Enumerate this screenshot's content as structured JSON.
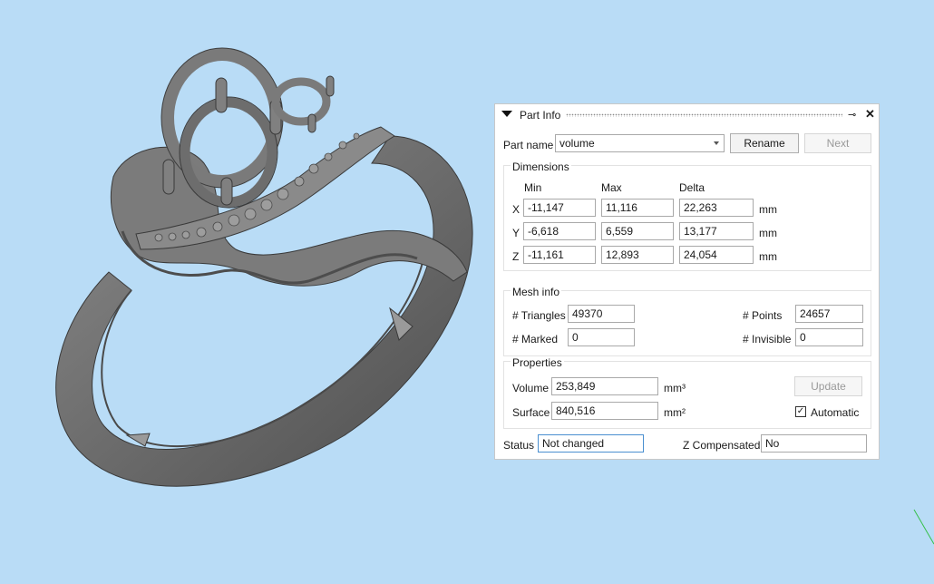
{
  "panel": {
    "title": "Part Info",
    "part_name_label": "Part name",
    "part_name_value": "volume",
    "rename_label": "Rename",
    "next_label": "Next",
    "dimensions": {
      "title": "Dimensions",
      "col_min": "Min",
      "col_max": "Max",
      "col_delta": "Delta",
      "unit": "mm",
      "rows": [
        {
          "axis": "X",
          "min": "-11,147",
          "max": "11,116",
          "delta": "22,263"
        },
        {
          "axis": "Y",
          "min": "-6,618",
          "max": "6,559",
          "delta": "13,177"
        },
        {
          "axis": "Z",
          "min": "-11,161",
          "max": "12,893",
          "delta": "24,054"
        }
      ]
    },
    "mesh": {
      "title": "Mesh info",
      "triangles_label": "# Triangles",
      "triangles_value": "49370",
      "points_label": "# Points",
      "points_value": "24657",
      "marked_label": "# Marked",
      "marked_value": "0",
      "invisible_label": "# Invisible",
      "invisible_value": "0"
    },
    "properties": {
      "title": "Properties",
      "volume_label": "Volume",
      "volume_value": "253,849",
      "volume_unit": "mm³",
      "surface_label": "Surface",
      "surface_value": "840,516",
      "surface_unit": "mm²",
      "update_label": "Update",
      "automatic_label": "Automatic",
      "automatic_checked": true
    },
    "status_label": "Status",
    "status_value": "Not changed",
    "zcomp_label": "Z Compensated",
    "zcomp_value": "No"
  },
  "colors": {
    "viewport_bg": "#b9dcf6",
    "model": "#6e6e6e"
  }
}
